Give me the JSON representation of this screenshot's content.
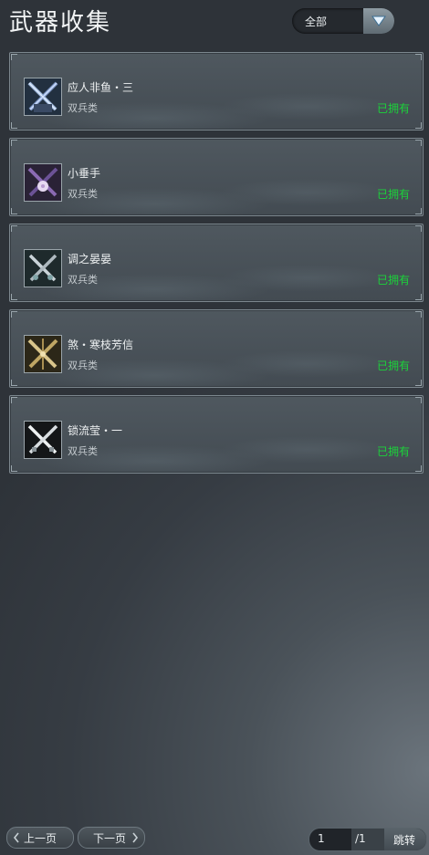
{
  "header": {
    "title": "武器收集",
    "filter": {
      "selected": "全部"
    }
  },
  "weapons": [
    {
      "name": "应人非鱼・三",
      "category": "双兵类",
      "status": "已拥有",
      "icon": "blue-crossed-blades-icon"
    },
    {
      "name": "小垂手",
      "category": "双兵类",
      "status": "已拥有",
      "icon": "purple-crossed-blades-flower-icon"
    },
    {
      "name": "调之晏晏",
      "category": "双兵类",
      "status": "已拥有",
      "icon": "silver-crossed-blades-icon"
    },
    {
      "name": "煞・寒枝芳信",
      "category": "双兵类",
      "status": "已拥有",
      "icon": "gold-crossed-blades-icon"
    },
    {
      "name": "锁流莹・一",
      "category": "双兵类",
      "status": "已拥有",
      "icon": "white-crossed-blades-icon"
    }
  ],
  "pagination": {
    "prev_label": "上一页",
    "next_label": "下一页",
    "current_page": "1",
    "total_pages": "/1",
    "jump_label": "跳转"
  },
  "colors": {
    "owned": "#1bd33a",
    "card_border": "#7c878e"
  }
}
